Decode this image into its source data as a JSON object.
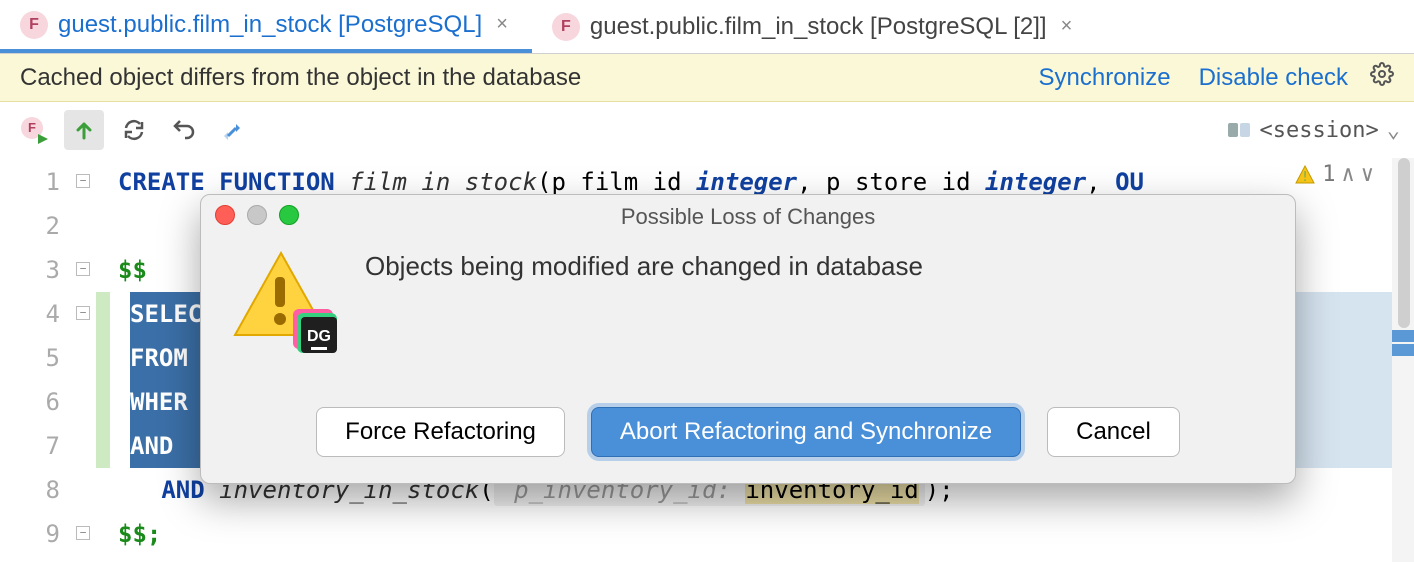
{
  "tabs": [
    {
      "icon": "F",
      "label": "guest.public.film_in_stock [PostgreSQL]",
      "active": true
    },
    {
      "icon": "F",
      "label": "guest.public.film_in_stock [PostgreSQL [2]]",
      "active": false
    }
  ],
  "banner": {
    "message": "Cached object differs from the object in the database",
    "link_sync": "Synchronize",
    "link_disable": "Disable check"
  },
  "toolbar": {
    "session_label": "<session>"
  },
  "warnings": {
    "count": "1"
  },
  "code": {
    "l1_kw1": "CREATE FUNCTION ",
    "l1_fn": "film_in_stock",
    "l1_paren": "(",
    "l1_p1": "p_film_id ",
    "l1_ty1": "integer",
    "l1_c1": ", ",
    "l1_p2": "p_store_id ",
    "l1_ty2": "integer",
    "l1_c2": ", ",
    "l1_ou": "OU",
    "l3": "$$",
    "l4": "SELEC",
    "l5": "FROM",
    "l6": "WHER",
    "l7": "AND",
    "l8_kw": "AND ",
    "l8_fn": "inventory_in_stock",
    "l8_paren": "(",
    "l8_hint": " p_inventory_id: ",
    "l8_arg": "inventory_id",
    "l8_close": ");",
    "l9": "$$;"
  },
  "dialog": {
    "title": "Possible Loss of Changes",
    "message": "Objects being modified are changed in database",
    "btn_force": "Force Refactoring",
    "btn_abort": "Abort Refactoring and Synchronize",
    "btn_cancel": "Cancel"
  }
}
